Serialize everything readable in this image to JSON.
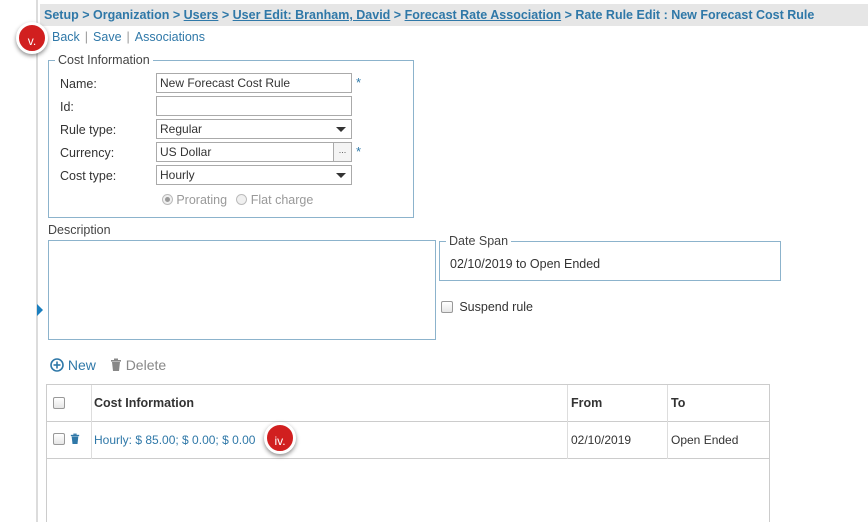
{
  "breadcrumb": {
    "setup": "Setup",
    "sep1": " > ",
    "organization": "Organization",
    "sep2": " > ",
    "users": "Users",
    "sep3": " > ",
    "user_edit": "User Edit: Branham, David",
    "sep4": " > ",
    "forecast_rate": "Forecast Rate Association",
    "sep5": " > ",
    "current": "Rate Rule Edit : New Forecast Cost Rule"
  },
  "toolbar": {
    "back": "Back",
    "sep": "|",
    "save": "Save",
    "associations": "Associations"
  },
  "callouts": {
    "v": "v.",
    "iv": "iv."
  },
  "cost_info": {
    "legend": "Cost Information",
    "name_label": "Name:",
    "name_value": "New Forecast Cost Rule",
    "id_label": "Id:",
    "id_value": "",
    "rule_type_label": "Rule type:",
    "rule_type_value": "Regular",
    "currency_label": "Currency:",
    "currency_value": "US Dollar",
    "lookup": "...",
    "cost_type_label": "Cost type:",
    "cost_type_value": "Hourly",
    "required_mark": "*",
    "prorating": "Prorating",
    "flat_charge": "Flat charge"
  },
  "description": {
    "label": "Description",
    "value": ""
  },
  "date_span": {
    "legend": "Date Span",
    "value": "02/10/2019 to Open Ended"
  },
  "suspend": {
    "label": "Suspend rule",
    "checked": false
  },
  "grid_tools": {
    "new": "New",
    "delete": "Delete"
  },
  "grid": {
    "columns": [
      "Cost Information",
      "From",
      "To"
    ],
    "rows": [
      {
        "cost_information": "Hourly: $ 85.00; $ 0.00; $ 0.00",
        "from": "02/10/2019",
        "to": "Open Ended"
      }
    ]
  },
  "colors": {
    "link": "#2f78a8",
    "callout": "#d11f1f",
    "fieldset_border": "#8cb3cc",
    "breadcrumb_bg": "#e6e6e6"
  }
}
